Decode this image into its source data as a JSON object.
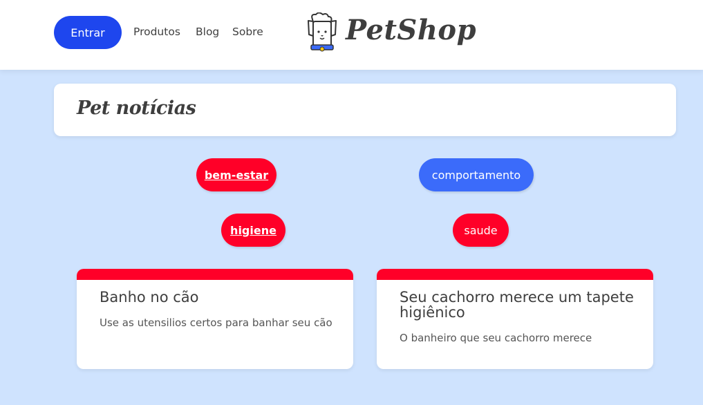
{
  "header": {
    "login_label": "Entrar",
    "nav": [
      "Produtos",
      "Blog",
      "Sobre"
    ],
    "logo_text": "PetShop"
  },
  "section": {
    "title": "Pet notícias"
  },
  "categories": [
    {
      "label": "bem-estar",
      "color": "#ff0028"
    },
    {
      "label": "comportamento",
      "color": "#3b6bfa"
    },
    {
      "label": "higiene",
      "color": "#ff0028"
    },
    {
      "label": "saude",
      "color": "#ff0028"
    }
  ],
  "posts": [
    {
      "title": "Banho no cão",
      "excerpt": "Use as utensilios certos para banhar seu cão",
      "bar_color": "#ff0028"
    },
    {
      "title": "Seu cachorro merece um tapete higiênico",
      "excerpt": "O banheiro que seu cachorro merece",
      "bar_color": "#ff0028"
    }
  ],
  "colors": {
    "page_bg": "#cfe3fe",
    "primary_button": "#1e46ee",
    "tag_red": "#ff0028",
    "tag_blue": "#3b6bfa"
  }
}
